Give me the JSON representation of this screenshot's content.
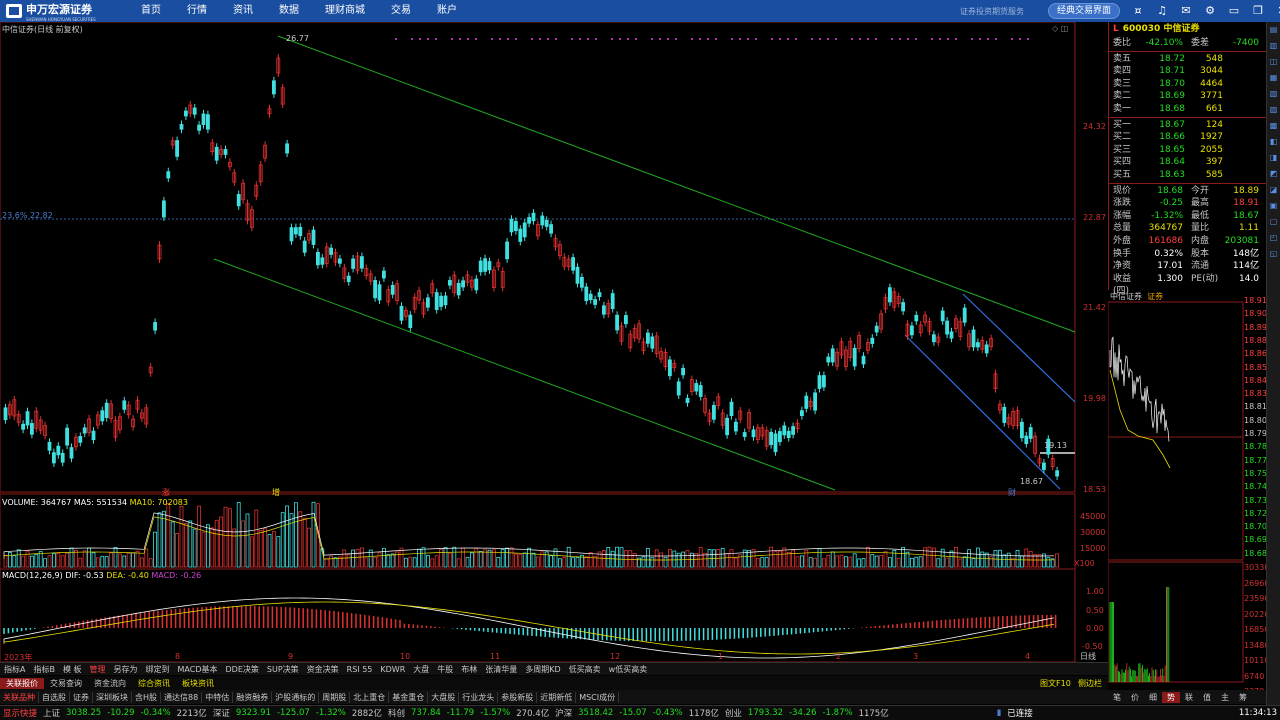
{
  "app": {
    "logo": "申万宏源证券",
    "logo_en": "SHENWAN HONGYUAN SECURITIES",
    "nav": [
      "首页",
      "行情",
      "资讯",
      "数据",
      "理财商城",
      "交易",
      "账户"
    ],
    "caption": "证券投资期货服务",
    "classic_btn": "经典交易界面"
  },
  "chart": {
    "title": "中信证券(日线 前复权)",
    "hi_label": "26.77",
    "lo_label": "18.67",
    "last_tag": "19.13",
    "fib": "23.6% 22.82",
    "yticks": [
      "24.32",
      "22.87",
      "21.42",
      "19.98",
      "18.53"
    ],
    "vol_header": {
      "a": "VOLUME: 364767",
      "b": "MA5: 551534",
      "c": "MA10: 702083"
    },
    "vol_ticks": [
      "45000",
      "30000",
      "15000",
      "X100"
    ],
    "macd_header": {
      "a": "MACD(12,26,9)",
      "b": "DIF: -0.53",
      "c": "DEA: -0.40",
      "d": "MACD: -0.26"
    },
    "macd_ticks": [
      "1.00",
      "0.50",
      "0.00",
      "-0.50"
    ],
    "months": [
      "2023年",
      "8",
      "9",
      "10",
      "11",
      "12",
      "1",
      "2",
      "3",
      "4"
    ],
    "marker_up": "涨",
    "marker_z": "增",
    "marker_c": "财",
    "period": "日线"
  },
  "quote": {
    "code": "600030",
    "name": "中信证券",
    "wb": {
      "label": "委比",
      "val": "-42.10%",
      "label2": "委差",
      "val2": "-7400"
    },
    "sells": [
      {
        "l": "卖五",
        "p": "18.72",
        "v": "548"
      },
      {
        "l": "卖四",
        "p": "18.71",
        "v": "3044"
      },
      {
        "l": "卖三",
        "p": "18.70",
        "v": "4464"
      },
      {
        "l": "卖二",
        "p": "18.69",
        "v": "3771"
      },
      {
        "l": "卖一",
        "p": "18.68",
        "v": "661"
      }
    ],
    "buys": [
      {
        "l": "买一",
        "p": "18.67",
        "v": "124"
      },
      {
        "l": "买二",
        "p": "18.66",
        "v": "1927"
      },
      {
        "l": "买三",
        "p": "18.65",
        "v": "2055"
      },
      {
        "l": "买四",
        "p": "18.64",
        "v": "397"
      },
      {
        "l": "买五",
        "p": "18.63",
        "v": "585"
      }
    ],
    "stats": [
      [
        "现价",
        "18.68",
        "今开",
        "18.89"
      ],
      [
        "涨跌",
        "-0.25",
        "最高",
        "18.91"
      ],
      [
        "涨幅",
        "-1.32%",
        "最低",
        "18.67"
      ],
      [
        "总量",
        "364767",
        "量比",
        "1.11"
      ],
      [
        "外盘",
        "161686",
        "内盘",
        "203081"
      ],
      [
        "换手",
        "0.32%",
        "股本",
        "148亿"
      ],
      [
        "净资",
        "17.01",
        "流通",
        "114亿"
      ],
      [
        "收益(四)",
        "1.300",
        "PE(动)",
        "14.0"
      ]
    ]
  },
  "mini": {
    "title": "中信证券",
    "tag": "证券",
    "prices": [
      "18.91",
      "18.90",
      "18.89",
      "18.88",
      "18.86",
      "18.85",
      "18.84",
      "18.83",
      "18.81",
      "18.80",
      "18.79",
      "18.78",
      "18.77",
      "18.75",
      "18.74",
      "18.73",
      "18.72",
      "18.70",
      "18.69",
      "18.68"
    ],
    "vols": [
      "30330",
      "26960",
      "23590",
      "20220",
      "16850",
      "13480",
      "10110",
      "6740",
      "3370"
    ]
  },
  "tabs": [
    "指标A",
    "指标B",
    "模 板",
    "管理",
    "另存为",
    "绑定到",
    "MACD基本",
    "DDE决策",
    "SUP决策",
    "资金决策",
    "RSI 55",
    "KDWR",
    "大盘",
    "牛股",
    "布林",
    "张清华量",
    "多周期KD",
    "低买高卖",
    "w低买高卖"
  ],
  "row2": [
    "关联报价",
    "交易查询",
    "资金流向",
    "综合资讯",
    "板块资讯"
  ],
  "row2_right": [
    "图文F10",
    "侧边栏"
  ],
  "row3": [
    "关联品种",
    "自选股",
    "证券",
    "深圳板块",
    "含H股",
    "通达信88",
    "中特估",
    "融资融券",
    "沪股通标的",
    "周期股",
    "北上重仓",
    "基金重仓",
    "大盘股",
    "行业龙头",
    "参股新股",
    "近期新低",
    "MSCI成份"
  ],
  "mtabs": [
    "笔",
    "价",
    "细",
    "势",
    "联",
    "值",
    "主",
    "筹"
  ],
  "status": {
    "label": "显示快捷",
    "sh": "上证",
    "sh_v": "3038.25",
    "sh_c": "-10.29",
    "sh_p": "-0.34%",
    "sh_a": "2213亿",
    "sz": "深证",
    "sz_v": "9323.91",
    "sz_c": "-125.07",
    "sz_p": "-1.32%",
    "sz_a": "2882亿",
    "kc": "科创",
    "kc_v": "737.84",
    "kc_c": "-11.79",
    "kc_p": "-1.57%",
    "kc_a": "270.4亿",
    "hs": "沪深",
    "hs_v": "3518.42",
    "hs_c": "-15.07",
    "hs_p": "-0.43%",
    "hs_a": "1178亿",
    "cy": "创业",
    "cy_v": "1793.32",
    "cy_c": "-34.26",
    "cy_p": "-1.87%",
    "cy_a": "1175亿",
    "conn": "已连接",
    "time": "11:34:13"
  }
}
